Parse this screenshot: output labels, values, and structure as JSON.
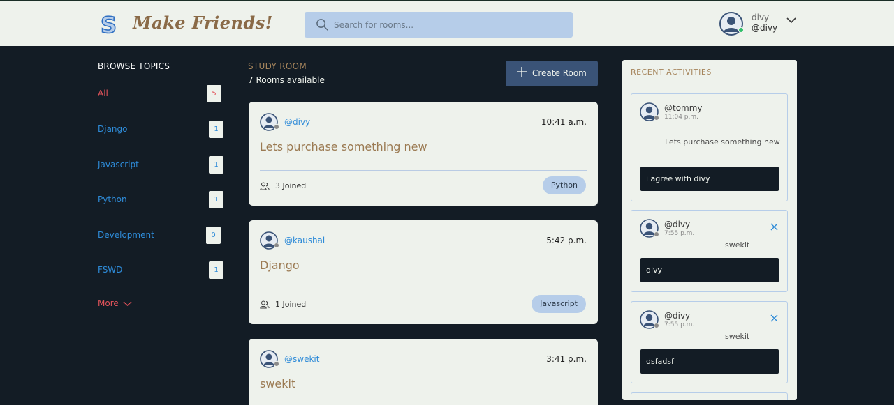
{
  "header": {
    "logo_letter": "S",
    "app_title": "Make Friends!",
    "search_placeholder": "Search for rooms...",
    "user_name": "divy",
    "user_handle": "@divy"
  },
  "sidebar": {
    "title": "BROWSE TOPICS",
    "topics": [
      {
        "label": "All",
        "count": "5"
      },
      {
        "label": "Django",
        "count": "1"
      },
      {
        "label": "Javascript",
        "count": "1"
      },
      {
        "label": "Python",
        "count": "1"
      },
      {
        "label": "Development",
        "count": "0"
      },
      {
        "label": "FSWD",
        "count": "1"
      }
    ],
    "more_label": "More"
  },
  "main": {
    "section_title": "STUDY ROOM",
    "rooms_available": "7 Rooms available",
    "create_button": "Create Room",
    "rooms": [
      {
        "host": "@divy",
        "time": "10:41 a.m.",
        "name": "Lets purchase something new",
        "joined": "3 Joined",
        "topic": "Python"
      },
      {
        "host": "@kaushal",
        "time": "5:42 p.m.",
        "name": "Django",
        "joined": "1 Joined",
        "topic": "Javascript"
      },
      {
        "host": "@swekit",
        "time": "3:41 p.m.",
        "name": "swekit"
      }
    ]
  },
  "activities": {
    "title": "RECENT ACTIVITIES",
    "items": [
      {
        "user": "@tommy",
        "time": "11:04 p.m.",
        "room": "Lets purchase something new",
        "message": "i agree with divy"
      },
      {
        "user": "@divy",
        "time": "7:55 p.m.",
        "room": "swekit",
        "message": "divy"
      },
      {
        "user": "@divy",
        "time": "7:55 p.m.",
        "room": "swekit",
        "message": "dsfadsf"
      }
    ]
  },
  "colors": {
    "background": "#131c25",
    "surface": "#eef2ec",
    "accent_blue": "#2e8bd8",
    "accent_red": "#e2535a",
    "accent_gold": "#a6855c",
    "button": "#3a5377"
  }
}
